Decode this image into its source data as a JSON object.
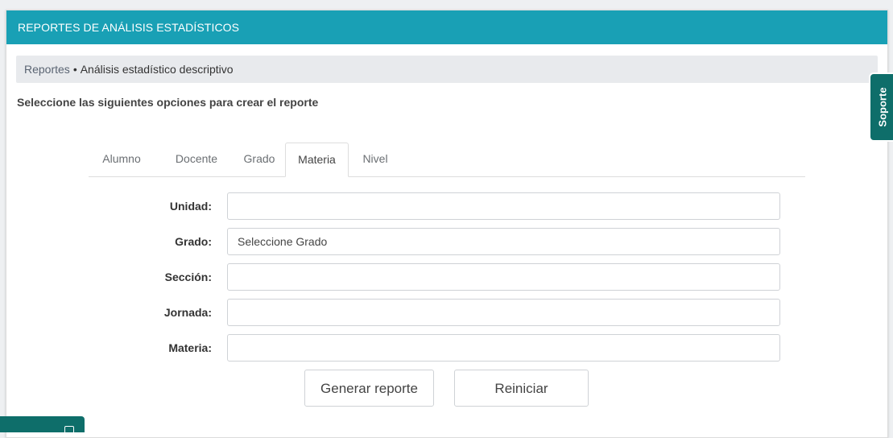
{
  "header": {
    "title": "REPORTES DE ANÁLISIS ESTADÍSTICOS"
  },
  "breadcrumb": {
    "parent": "Reportes",
    "separator": "•",
    "current": "Análisis estadístico descriptivo"
  },
  "instructions": "Seleccione las siguientes opciones para crear el reporte",
  "tabs": [
    {
      "label": "Alumno",
      "active": false
    },
    {
      "label": "Docente",
      "active": false
    },
    {
      "label": "Grado",
      "active": false
    },
    {
      "label": "Materia",
      "active": true
    },
    {
      "label": "Nivel",
      "active": false
    }
  ],
  "form": {
    "fields": [
      {
        "label": "Unidad:",
        "value": "",
        "placeholder": ""
      },
      {
        "label": "Grado:",
        "value": "Seleccione Grado",
        "placeholder": ""
      },
      {
        "label": "Sección:",
        "value": "",
        "placeholder": ""
      },
      {
        "label": "Jornada:",
        "value": "",
        "placeholder": ""
      },
      {
        "label": "Materia:",
        "value": "",
        "placeholder": ""
      }
    ]
  },
  "buttons": {
    "generate": "Generar reporte",
    "reset": "Reiniciar"
  },
  "support": {
    "label": "Soporte"
  },
  "colors": {
    "header": "#19a0b5",
    "support": "#0e6e6a"
  }
}
